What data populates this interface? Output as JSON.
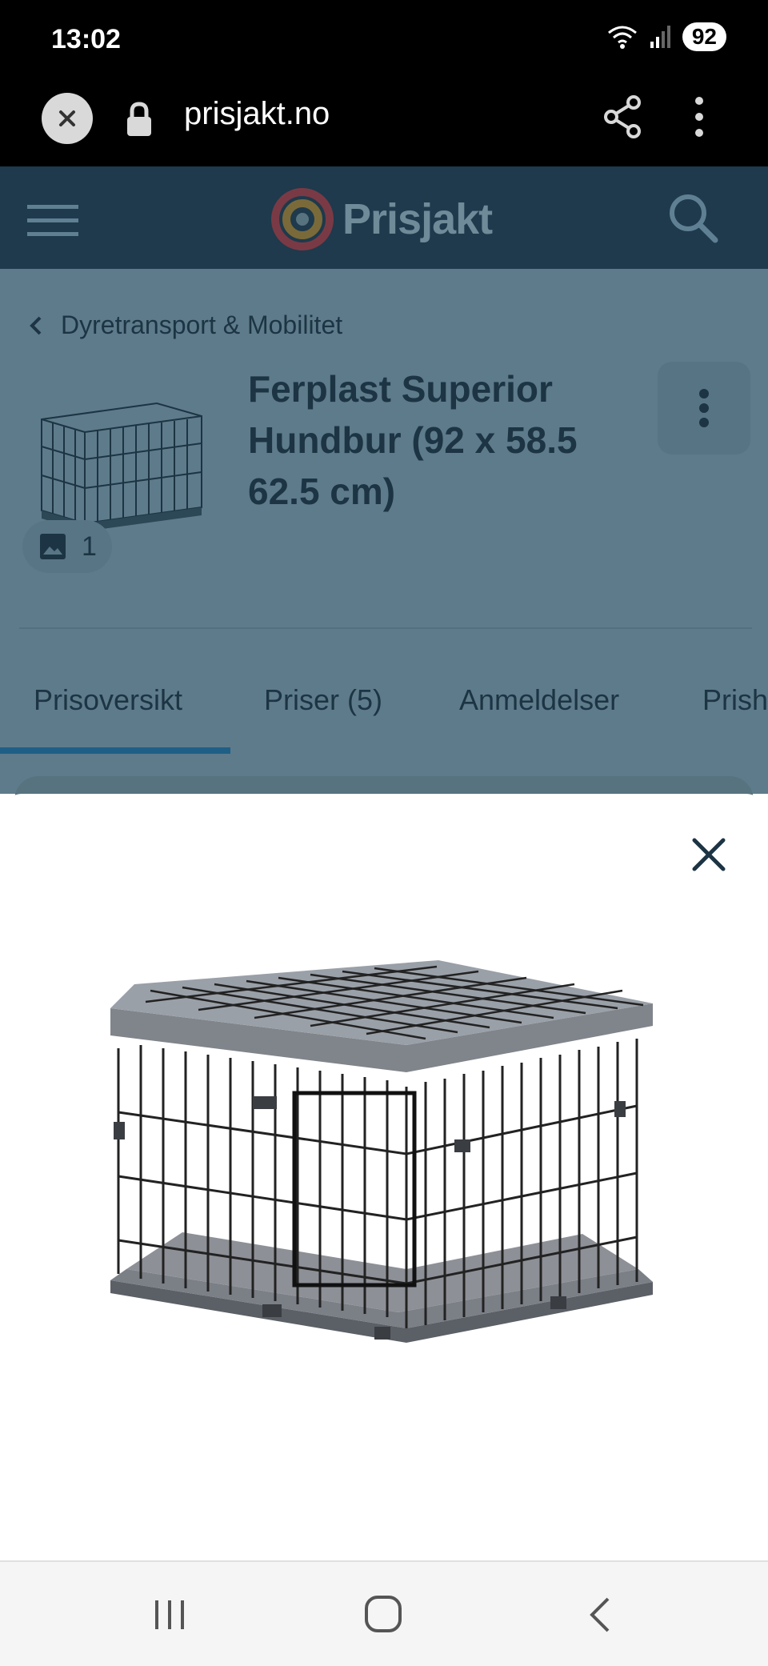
{
  "status": {
    "time": "13:02",
    "battery": "92"
  },
  "browser": {
    "url": "prisjakt.no"
  },
  "site": {
    "logo_text": "Prisjakt"
  },
  "breadcrumb": {
    "label": "Dyretransport & Mobilitet"
  },
  "product": {
    "title": "Ferplast Superior Hundbur (92 x 58.5 62.5 cm)",
    "image_count": "1"
  },
  "tabs": [
    {
      "label": "Prisoversikt",
      "active": true
    },
    {
      "label": "Priser (5)"
    },
    {
      "label": "Anmeldelser"
    },
    {
      "label": "Prish"
    }
  ],
  "colors": {
    "header_bg": "#1e3a4c",
    "overlay_bg": "#5e7b8b",
    "tab_accent": "#1f5f86",
    "text_dark": "#1c3443"
  },
  "icons": [
    "close-icon",
    "lock-icon",
    "share-icon",
    "more-vertical-icon",
    "menu-icon",
    "search-icon",
    "chevron-left-icon",
    "image-icon",
    "recent-apps-icon",
    "home-icon",
    "back-icon"
  ]
}
